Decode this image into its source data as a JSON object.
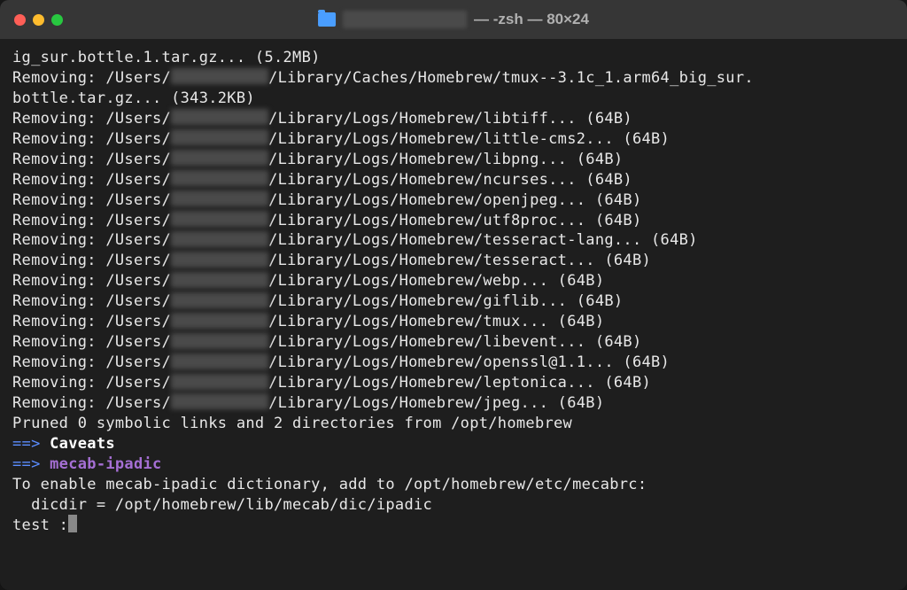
{
  "titlebar": {
    "title_suffix": "— -zsh — 80×24"
  },
  "terminal": {
    "line1": "ig_sur.bottle.1.tar.gz... (5.2MB)",
    "removing_prefix": "Removing: /Users/",
    "line2_suffix": "/Library/Caches/Homebrew/tmux--3.1c_1.arm64_big_sur.",
    "line3": "bottle.tar.gz... (343.2KB)",
    "log_lines": [
      "/Library/Logs/Homebrew/libtiff... (64B)",
      "/Library/Logs/Homebrew/little-cms2... (64B)",
      "/Library/Logs/Homebrew/libpng... (64B)",
      "/Library/Logs/Homebrew/ncurses... (64B)",
      "/Library/Logs/Homebrew/openjpeg... (64B)",
      "/Library/Logs/Homebrew/utf8proc... (64B)",
      "/Library/Logs/Homebrew/tesseract-lang... (64B)",
      "/Library/Logs/Homebrew/tesseract... (64B)",
      "/Library/Logs/Homebrew/webp... (64B)",
      "/Library/Logs/Homebrew/giflib... (64B)",
      "/Library/Logs/Homebrew/tmux... (64B)",
      "/Library/Logs/Homebrew/libevent... (64B)",
      "/Library/Logs/Homebrew/openssl@1.1... (64B)",
      "/Library/Logs/Homebrew/leptonica... (64B)",
      "/Library/Logs/Homebrew/jpeg... (64B)"
    ],
    "pruned": "Pruned 0 symbolic links and 2 directories from /opt/homebrew",
    "arrow": "==> ",
    "caveats": "Caveats",
    "mecab": "mecab-ipadic",
    "enable_line": "To enable mecab-ipadic dictionary, add to /opt/homebrew/etc/mecabrc:",
    "dicdir_line": "  dicdir = /opt/homebrew/lib/mecab/dic/ipadic",
    "prompt": "test :"
  }
}
